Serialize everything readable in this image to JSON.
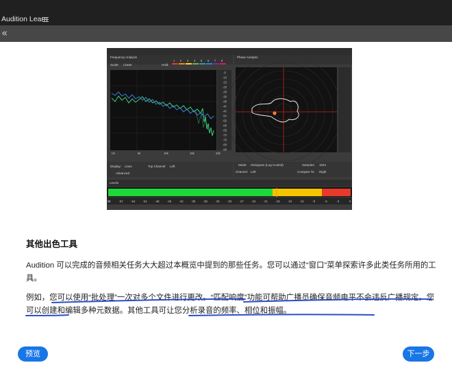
{
  "app": {
    "title": "Audition Learn"
  },
  "nav": {
    "collapse_glyph": "«"
  },
  "screenshot": {
    "freq_panel_title": "Frequency Analysis",
    "phase_panel_title": "Phase Analysis",
    "levels_panel_title": "Levels",
    "scale_label": "Scale:",
    "scale_value": "Linear",
    "hold_label": "Hold:",
    "hold_numbers": [
      "1",
      "2",
      "3",
      "4",
      "5",
      "6",
      "7",
      "8"
    ],
    "hold_colors": [
      "#e53935",
      "#fb8c00",
      "#fdd835",
      "#7cb342",
      "#26a69a",
      "#1e88e5",
      "#8e24aa",
      "#d81b60"
    ],
    "x_ticks": [
      "Hz",
      "5k",
      "10k",
      "15k",
      "20k"
    ],
    "db_ticks": [
      "-5",
      "-10",
      "-15",
      "-20",
      "-25",
      "-30",
      "-35",
      "-40",
      "-45",
      "-50",
      "-55",
      "-60",
      "-65",
      "-70",
      "-75",
      "-80",
      "-90"
    ],
    "display_label": "Display:",
    "display_value": "Lines",
    "top_channel_label": "Top Channel:",
    "top_channel_value": "Left",
    "advanced_label": "Advanced",
    "mode_label": "Mode:",
    "mode_value": "Histogram (Log Cooled)",
    "samples_label": "Samples:",
    "samples_value": "1024",
    "channel_label": "Channel:",
    "channel_value": "Left",
    "compare_label": "Compare To:",
    "compare_value": "Right",
    "level_ticks": [
      "dB",
      "-57",
      "-54",
      "-51",
      "-48",
      "-45",
      "-42",
      "-39",
      "-36",
      "-33",
      "-30",
      "-27",
      "-24",
      "-21",
      "-18",
      "-15",
      "-12",
      "-9",
      "-6",
      "-3",
      "0"
    ],
    "colors": {
      "freq_green": "#3ccf7a",
      "freq_blue": "#3f7fd8",
      "meter_green": "#1ed83a",
      "meter_yellow": "#f5c400",
      "meter_red": "#e83a2a",
      "crosshair": "#cc1f1f"
    }
  },
  "content": {
    "heading": "其他出色工具",
    "para1": "Audition 可以完成的音频相关任务大大超过本概览中提到的那些任务。您可以通过“窗口”菜单探索许多此类任务所用的工具。",
    "para2": "例如，您可以使用“批处理”一次对多个文件进行更改。“匹配响度”功能可帮助广播员确保音频电平不会违反广播规定。您可以创建和编辑多种元数据。其他工具可让您分析录音的频率、相位和振幅。",
    "annotation_color": "#2a4fc8"
  },
  "footer": {
    "prev_label": "预览",
    "next_label": "下一步"
  }
}
